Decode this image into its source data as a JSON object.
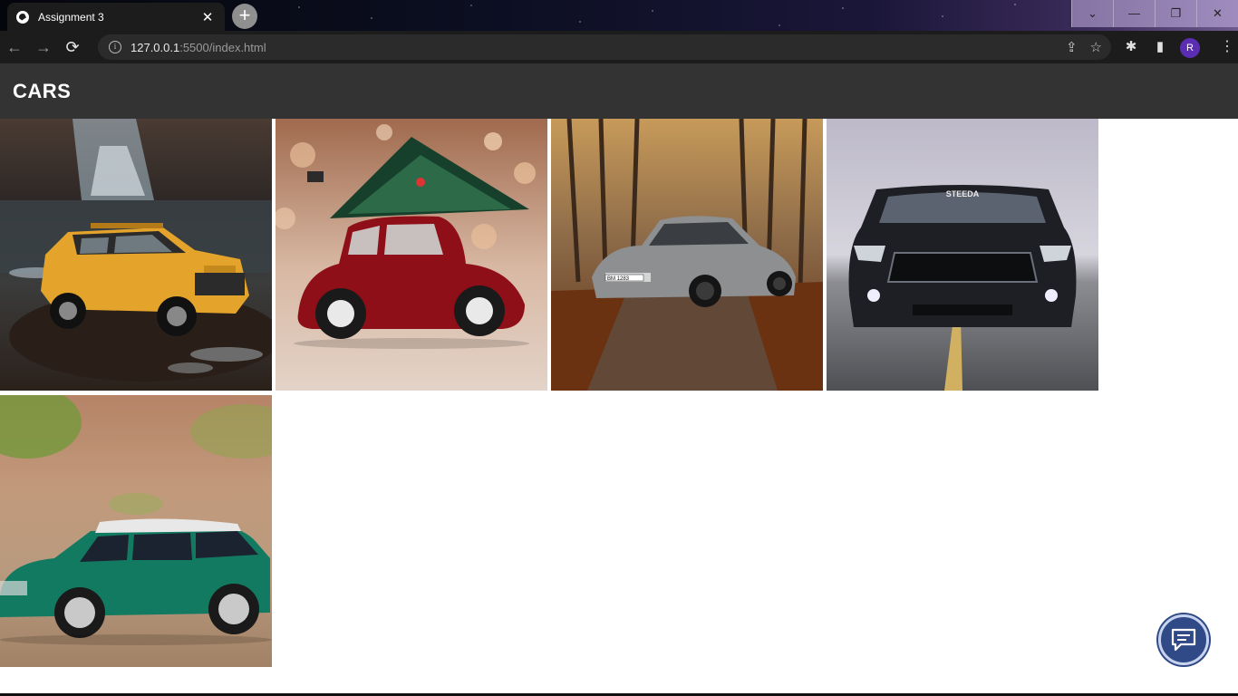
{
  "browser": {
    "tab_title": "Assignment 3",
    "tab_close": "✕",
    "new_tab": "+",
    "url_host": "127.0.0.1",
    "url_path": ":5500/index.html",
    "profile_initial": "R",
    "window_controls": [
      "⌄",
      "—",
      "❐",
      "✕"
    ]
  },
  "page": {
    "heading": "CARS"
  },
  "gallery": {
    "images": [
      {
        "subject": "yellow toy Hummer by waterfall"
      },
      {
        "subject": "red toy beetle carrying christmas tree"
      },
      {
        "subject": "grey BMW in autumn forest"
      },
      {
        "subject": "black Mustang on road"
      },
      {
        "subject": "green toy Mini Cooper"
      }
    ],
    "plate_text": "BM 1283",
    "windshield_text": "STEEDA"
  },
  "icons": {
    "chat": "chat-bubble-icon"
  }
}
